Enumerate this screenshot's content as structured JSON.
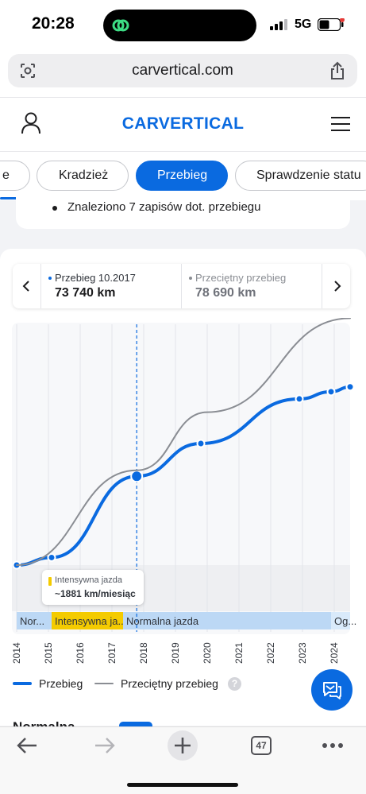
{
  "status_bar": {
    "time": "20:28",
    "network": "5G"
  },
  "browser": {
    "url": "carvertical.com",
    "tab_count": "47"
  },
  "site": {
    "logo_text": "CARVERTICAL",
    "brand_color": "#0a6ae0"
  },
  "tabs": [
    {
      "label": "e",
      "active": false
    },
    {
      "label": "Kradzież",
      "active": false
    },
    {
      "label": "Przebieg",
      "active": true
    },
    {
      "label": "Sprawdzenie statu",
      "active": false
    }
  ],
  "summary": {
    "bullet": "Znaleziono 7 zapisów dot. przebiegu"
  },
  "selection": {
    "left": {
      "label": "Przebieg 10.2017",
      "value": "73 740 km",
      "color": "#0a6ae0"
    },
    "right": {
      "label": "Przeciętny przebieg",
      "value": "78 690 km",
      "color": "#8a8d93"
    }
  },
  "chart_data": {
    "type": "line",
    "x_tick_labels": [
      "2014",
      "2015",
      "2016",
      "2017",
      "2018",
      "2019",
      "2020",
      "2021",
      "2022",
      "2023",
      "2024"
    ],
    "x_range": [
      2014,
      2024.5
    ],
    "y_range": [
      0,
      200000
    ],
    "grid": true,
    "series": [
      {
        "name": "Przebieg",
        "color": "#0a6ae0",
        "markers": true,
        "points": [
          [
            2014.0,
            0
          ],
          [
            2015.1,
            6300
          ],
          [
            2017.78,
            73740
          ],
          [
            2019.8,
            101000
          ],
          [
            2022.9,
            138000
          ],
          [
            2023.9,
            144000
          ],
          [
            2024.5,
            148000
          ]
        ]
      },
      {
        "name": "Przeciętny przebieg",
        "color": "#8a8d93",
        "markers": false,
        "points": [
          [
            2014.0,
            0
          ],
          [
            2017.78,
            78690
          ],
          [
            2020.0,
            127000
          ],
          [
            2024.5,
            205000
          ]
        ]
      }
    ],
    "selected_x": 2017.78,
    "baseline_region_label": "",
    "tooltip": {
      "title": "Intensywna jazda",
      "value": "~1881 km/miesiąc"
    },
    "bands": [
      {
        "label": "Nor...",
        "from": 2014.0,
        "to": 2015.1,
        "color": "#bcd8f5"
      },
      {
        "label": "Intensywna ja...",
        "from": 2015.1,
        "to": 2017.35,
        "color": "#f4cb00"
      },
      {
        "label": "Normalna jazda",
        "from": 2017.35,
        "to": 2023.9,
        "color": "#bcd8f5"
      },
      {
        "label": "Og...",
        "from": 2023.9,
        "to": 2024.5,
        "color": "#d9eafb"
      }
    ]
  },
  "legend": [
    {
      "label": "Przebieg",
      "color": "#0a6ae0"
    },
    {
      "label": "Przeciętny przebieg",
      "color": "#8a8d93"
    }
  ],
  "help_glyph": "?",
  "next_section_peek": "Normalna jazda"
}
